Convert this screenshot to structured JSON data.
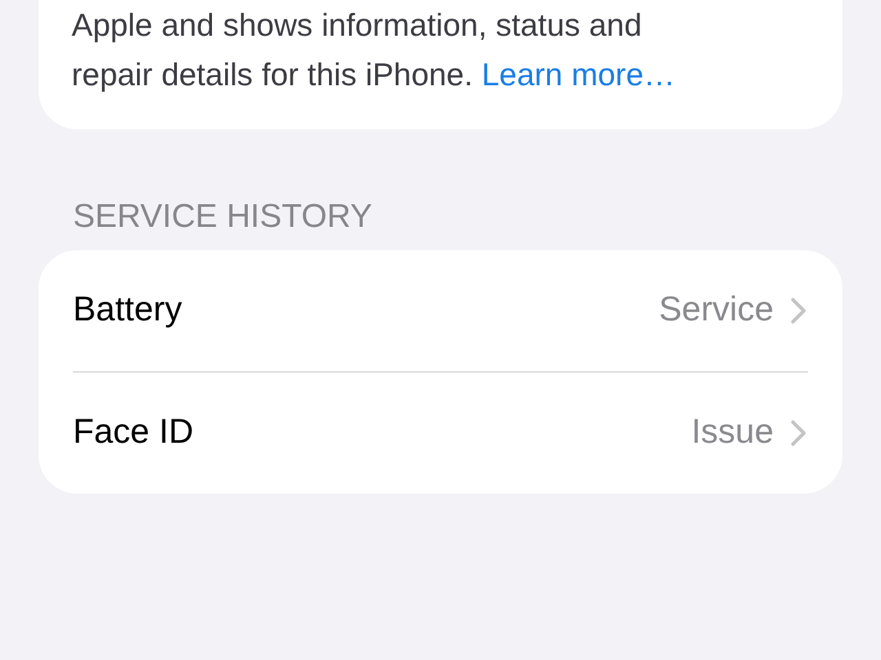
{
  "info_card": {
    "lines": [
      "Apple and shows information, status and",
      "repair details for this iPhone."
    ],
    "link": "Learn more…"
  },
  "section_header": "SERVICE HISTORY",
  "rows": [
    {
      "label": "Battery",
      "value": "Service"
    },
    {
      "label": "Face ID",
      "value": "Issue"
    }
  ]
}
